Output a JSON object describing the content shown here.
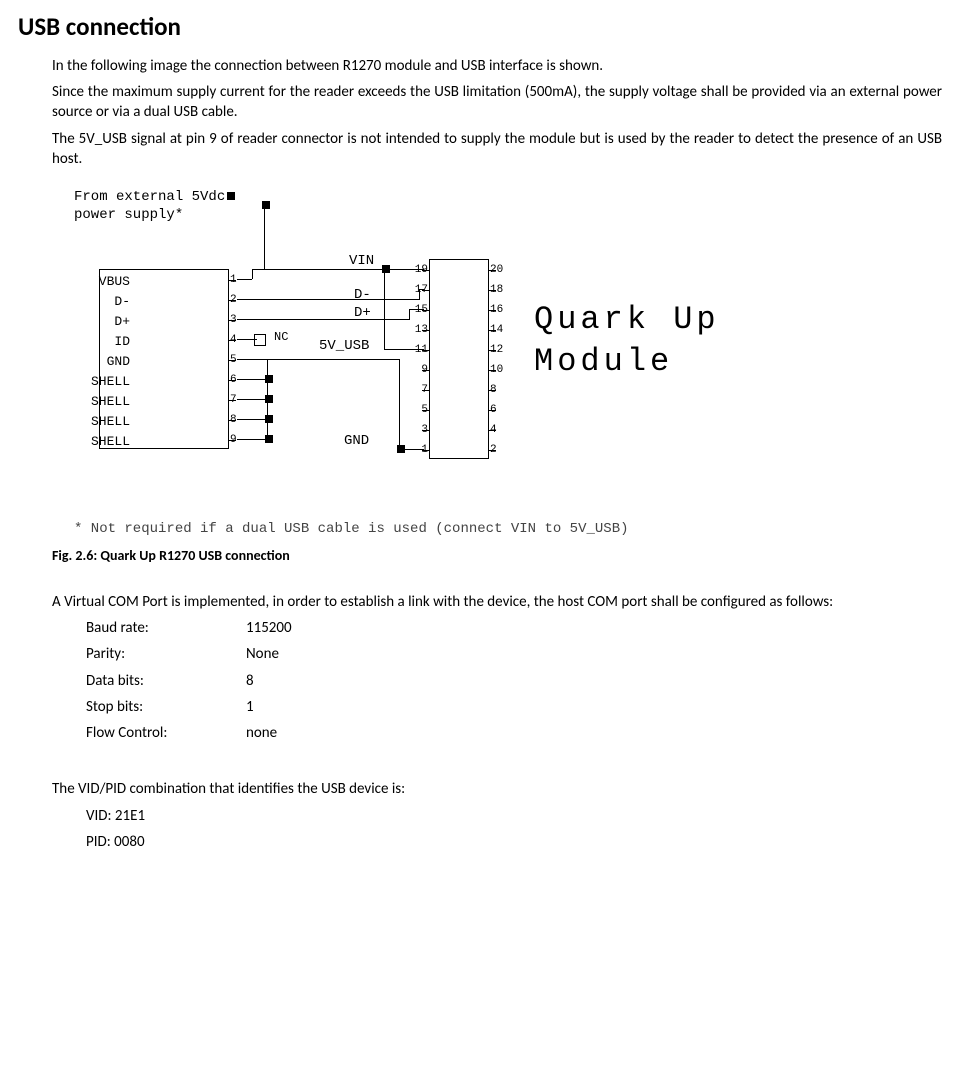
{
  "title": "USB connection",
  "para1": "In the following image the connection between R1270 module and USB interface is shown.",
  "para2": "Since the maximum supply current for the reader exceeds the USB limitation (500mA), the supply voltage shall be provided via an external power source or via a dual USB cable.",
  "para3": "The 5V_USB signal at pin 9 of reader connector is not intended to supply the module but is used by the reader to detect the presence of an USB host.",
  "note_top_l1": "From external 5Vdc",
  "note_top_l2": "power supply*",
  "usb_pins": [
    "VBUS",
    "D-",
    "D+",
    "ID",
    "GND",
    "SHELL",
    "SHELL",
    "SHELL",
    "SHELL"
  ],
  "usb_nums": [
    "1",
    "2",
    "3",
    "4",
    "5",
    "6",
    "7",
    "8",
    "9"
  ],
  "nets": {
    "vin": "VIN",
    "dminus": "D-",
    "dplus": "D+",
    "vusb": "5V_USB",
    "gnd": "GND",
    "nc": "NC"
  },
  "mod_left": [
    "19",
    "17",
    "15",
    "13",
    "11",
    "9",
    "7",
    "5",
    "3",
    "1"
  ],
  "mod_right": [
    "20",
    "18",
    "16",
    "14",
    "12",
    "10",
    "8",
    "6",
    "4",
    "2"
  ],
  "module_line1": "Quark Up",
  "module_line2": "Module",
  "footnote": "* Not required if a dual USB cable is used (connect VIN to 5V_USB)",
  "fig_caption": "Fig. 2.6: Quark Up R1270 USB connection",
  "vcp_intro": "A Virtual COM Port is implemented, in order to establish a link with the device, the host COM port shall be configured as follows:",
  "specs": [
    {
      "label": "Baud rate:",
      "value": "115200"
    },
    {
      "label": "Parity:",
      "value": "None"
    },
    {
      "label": "Data bits:",
      "value": "8"
    },
    {
      "label": "Stop bits:",
      "value": "1"
    },
    {
      "label": "Flow Control:",
      "value": "none"
    }
  ],
  "vidpid_intro": "The VID/PID combination that identifies the USB device is:",
  "vid": "VID: 21E1",
  "pid": "PID: 0080"
}
